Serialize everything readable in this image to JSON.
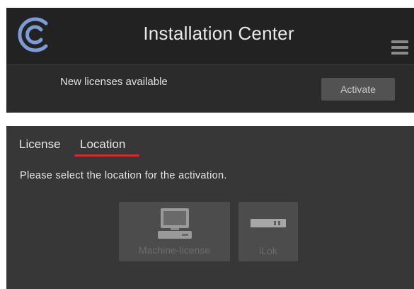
{
  "header": {
    "title": "Installation Center",
    "logo_icon": "c-logo-icon",
    "menu_icon": "hamburger-menu-icon"
  },
  "notification": {
    "text": "New licenses available",
    "activate_label": "Activate"
  },
  "tabs": [
    {
      "label": "License",
      "active": false
    },
    {
      "label": "Location",
      "active": true
    }
  ],
  "instruction": "Please select the location for the activation.",
  "options": [
    {
      "label": "Machine-license",
      "icon": "computer-icon"
    },
    {
      "label": "iLok",
      "icon": "ilok-dongle-icon"
    }
  ],
  "colors": {
    "header_bg": "#222222",
    "panel_bg": "#373737",
    "accent_underline": "#d42a2a",
    "logo_blue": "#7d9bd6",
    "disabled_text": "#6c6c6c"
  }
}
